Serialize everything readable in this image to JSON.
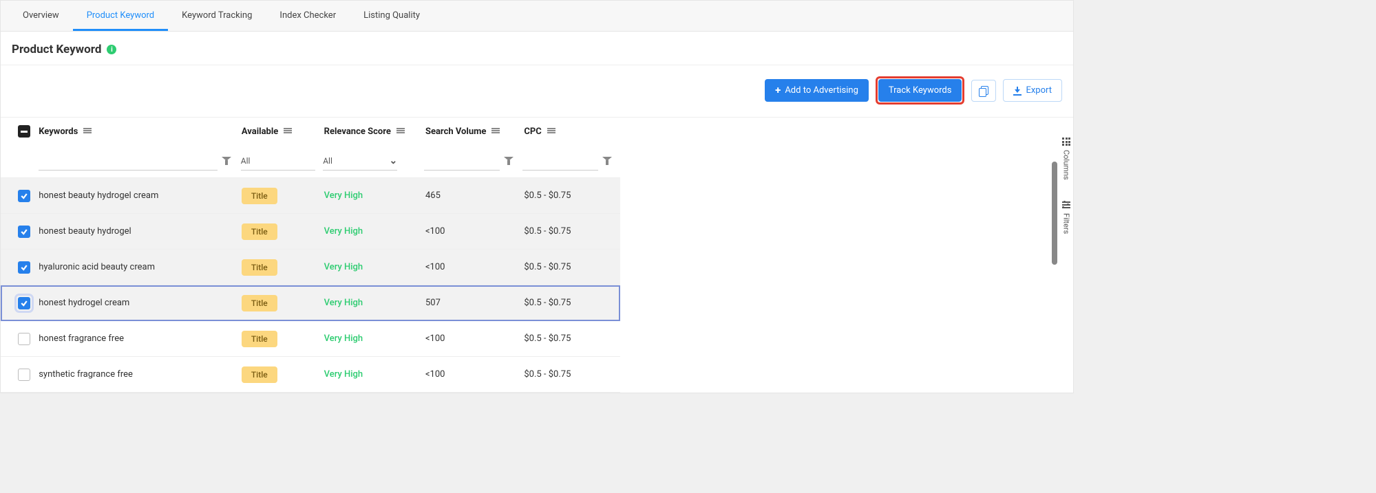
{
  "tabs": {
    "overview": "Overview",
    "product_keyword": "Product Keyword",
    "keyword_tracking": "Keyword Tracking",
    "index_checker": "Index Checker",
    "listing_quality": "Listing Quality"
  },
  "page_title": "Product Keyword",
  "actions": {
    "add_advertising": "Add to Advertising",
    "track_keywords": "Track Keywords",
    "export": "Export"
  },
  "columns": {
    "keywords": "Keywords",
    "available": "Available",
    "relevance": "Relevance Score",
    "search_volume": "Search Volume",
    "cpc": "CPC"
  },
  "filters": {
    "available": "All",
    "relevance": "All"
  },
  "rows": [
    {
      "checked": true,
      "focus": false,
      "keyword": "honest beauty hydrogel cream",
      "available": "Title",
      "relevance": "Very High",
      "volume": "465",
      "cpc": "$0.5 - $0.75"
    },
    {
      "checked": true,
      "focus": false,
      "keyword": "honest beauty hydrogel",
      "available": "Title",
      "relevance": "Very High",
      "volume": "<100",
      "cpc": "$0.5 - $0.75"
    },
    {
      "checked": true,
      "focus": false,
      "keyword": "hyaluronic acid beauty cream",
      "available": "Title",
      "relevance": "Very High",
      "volume": "<100",
      "cpc": "$0.5 - $0.75"
    },
    {
      "checked": true,
      "focus": true,
      "keyword": "honest hydrogel cream",
      "available": "Title",
      "relevance": "Very High",
      "volume": "507",
      "cpc": "$0.5 - $0.75"
    },
    {
      "checked": false,
      "focus": false,
      "keyword": "honest fragrance free",
      "available": "Title",
      "relevance": "Very High",
      "volume": "<100",
      "cpc": "$0.5 - $0.75"
    },
    {
      "checked": false,
      "focus": false,
      "keyword": "synthetic fragrance free",
      "available": "Title",
      "relevance": "Very High",
      "volume": "<100",
      "cpc": "$0.5 - $0.75"
    }
  ],
  "rail": {
    "columns": "Columns",
    "filters": "Filters"
  },
  "colors": {
    "accent": "#2680eb",
    "highlight": "#e43d30",
    "badge": "#fcd77f",
    "relevance_high": "#2ecc71"
  }
}
